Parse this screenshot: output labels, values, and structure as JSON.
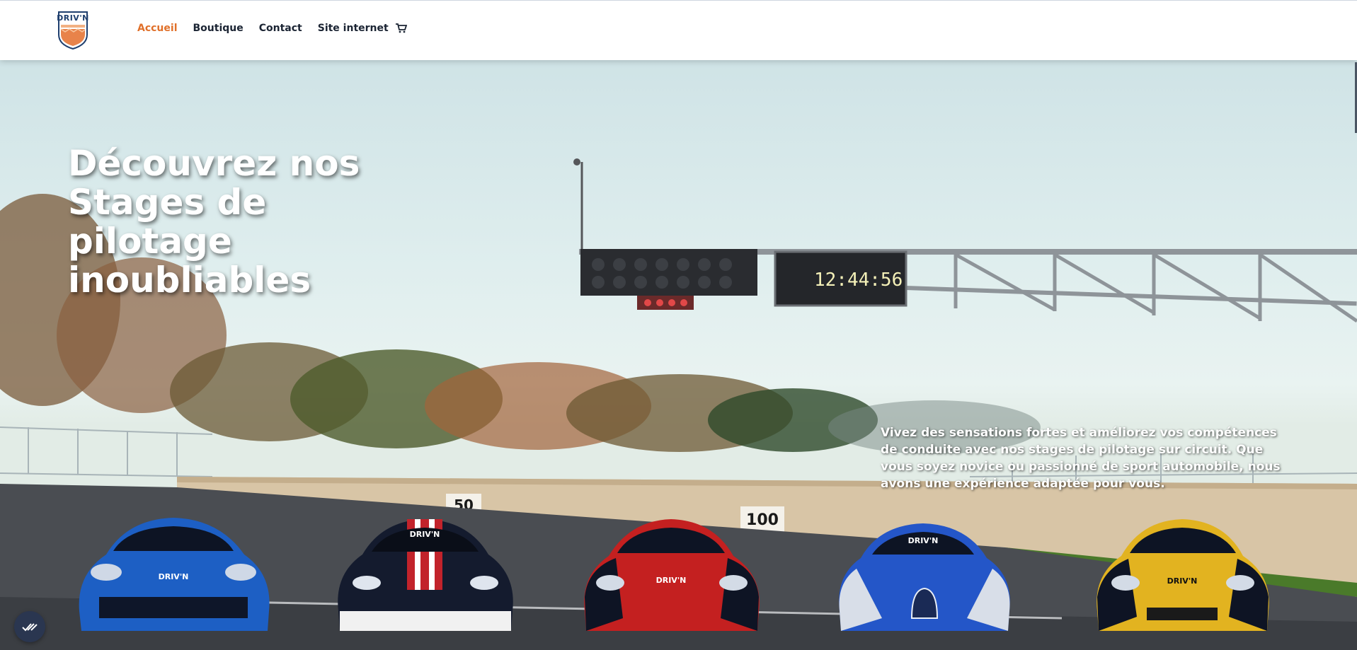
{
  "brand": {
    "logo_text": "DRIV'N",
    "accent_color": "#e0702a",
    "text_color": "#1b2433"
  },
  "nav": {
    "items": [
      {
        "label": "Accueil",
        "active": true
      },
      {
        "label": "Boutique",
        "active": false
      },
      {
        "label": "Contact",
        "active": false
      },
      {
        "label": "Site internet",
        "active": false
      }
    ],
    "cart_icon": "shopping-cart-icon"
  },
  "hero": {
    "title": "Découvrez nos Stages de pilotage inoubliables",
    "description": "Vivez des sensations fortes et améliorez vos compétences de conduite avec nos stages de pilotage sur circuit. Que vous soyez novice ou passionné de sport automobile, nous avons une expérience adaptée pour vous.",
    "image": {
      "gantry_clock": "12:44:56",
      "distance_boards": [
        "50",
        "100"
      ],
      "car_livery_text": "DRIV'N",
      "car_colors": [
        "#1d5fc4",
        "#141b2e",
        "#c42020",
        "#2456c8",
        "#e2b320"
      ]
    }
  },
  "floating_button_icon": "check-double-icon"
}
